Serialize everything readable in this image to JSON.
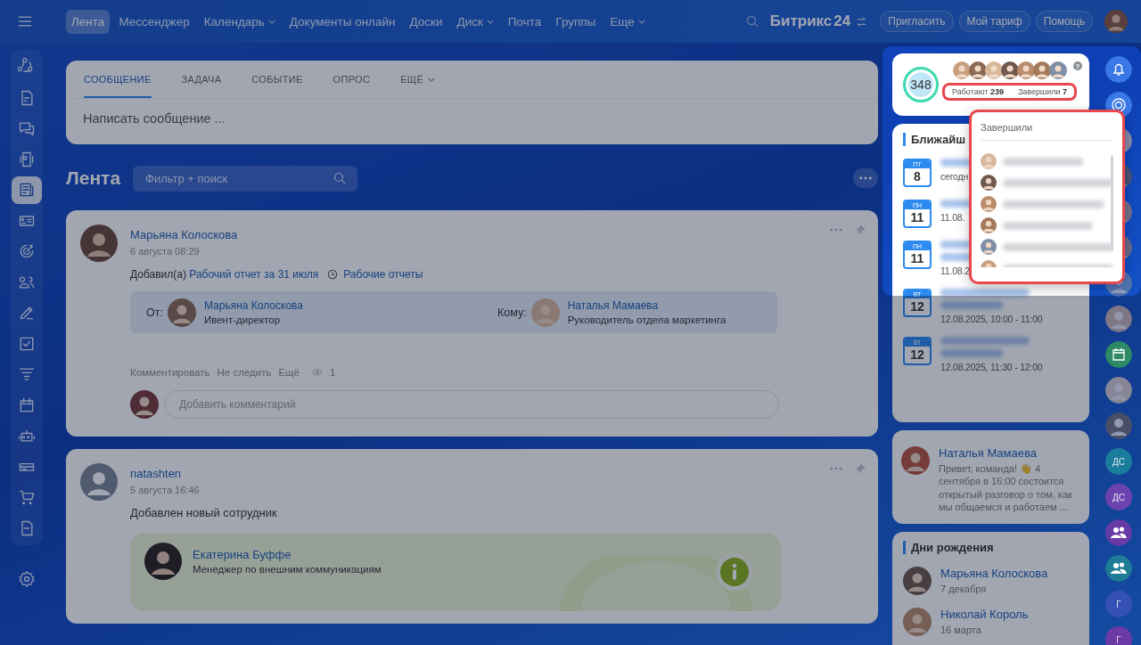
{
  "topbar": {
    "menu": [
      {
        "label": "Лента",
        "selected": true,
        "dropdown": false
      },
      {
        "label": "Мессенджер",
        "selected": false,
        "dropdown": false
      },
      {
        "label": "Календарь",
        "selected": false,
        "dropdown": true
      },
      {
        "label": "Документы онлайн",
        "selected": false,
        "dropdown": false
      },
      {
        "label": "Доски",
        "selected": false,
        "dropdown": false
      },
      {
        "label": "Диск",
        "selected": false,
        "dropdown": true
      },
      {
        "label": "Почта",
        "selected": false,
        "dropdown": false
      },
      {
        "label": "Группы",
        "selected": false,
        "dropdown": false
      },
      {
        "label": "Еще",
        "selected": false,
        "dropdown": true
      }
    ],
    "logo": {
      "name": "Битрикс",
      "number": "24"
    },
    "buttons": [
      "Пригласить",
      "Мой тариф",
      "Помощь"
    ]
  },
  "sidebar": {
    "items": [
      {
        "selected": false
      },
      {
        "selected": false
      },
      {
        "selected": false
      },
      {
        "selected": false
      },
      {
        "selected": true
      },
      {
        "selected": false
      },
      {
        "selected": false
      },
      {
        "selected": false
      },
      {
        "selected": false
      },
      {
        "selected": false
      },
      {
        "selected": false
      },
      {
        "selected": false
      },
      {
        "selected": false
      },
      {
        "selected": false
      },
      {
        "selected": false
      },
      {
        "selected": false
      }
    ]
  },
  "composer": {
    "tabs": [
      {
        "label": "СООБЩЕНИЕ",
        "selected": true,
        "dropdown": false
      },
      {
        "label": "ЗАДАЧА",
        "selected": false,
        "dropdown": false
      },
      {
        "label": "СОБЫТИЕ",
        "selected": false,
        "dropdown": false
      },
      {
        "label": "ОПРОС",
        "selected": false,
        "dropdown": false
      },
      {
        "label": "ЕЩЁ",
        "selected": false,
        "dropdown": true
      }
    ],
    "placeholder": "Написать сообщение ..."
  },
  "feed": {
    "title": "Лента",
    "search": {
      "placeholder": "Фильтр + поиск"
    }
  },
  "posts": [
    {
      "kind": "report",
      "author": "Марьяна Колоскова",
      "date": "6 августа 08:29",
      "action": "Добавил(а)",
      "link": "Рабочий отчет за 31 июля",
      "tag": "Рабочие отчеты",
      "from": {
        "label": "От:",
        "name": "Марьяна Колоскова",
        "role": "Ивент-директор"
      },
      "to": {
        "label": "Кому:",
        "name": "Наталья Мамаева",
        "role": "Руководитель отдела маркетинга"
      },
      "actions": [
        "Комментировать",
        "Не следить",
        "Ещё"
      ],
      "views": "1",
      "comment_placeholder": "Добавить комментарий"
    },
    {
      "kind": "employee",
      "author": "natashten",
      "date": "5 августа 16:46",
      "text": "Добавлен новый сотрудник",
      "employee": {
        "name": "Екатерина Буффе",
        "role": "Менеджер по внешним коммуникациям"
      }
    }
  ],
  "widget": {
    "count": "348",
    "help": "?",
    "stats": [
      {
        "label": "Работают",
        "value": "239"
      },
      {
        "label": "Завершили",
        "value": "7"
      }
    ]
  },
  "popup": {
    "title": "Завершили"
  },
  "events": {
    "title": "Ближайш",
    "items": [
      {
        "dow": "ПТ",
        "day": "8",
        "time": "сегодн"
      },
      {
        "dow": "ПН",
        "day": "11",
        "time": "11.08."
      },
      {
        "dow": "ПН",
        "day": "11",
        "time": "11.08.2"
      },
      {
        "dow": "ВТ",
        "day": "12",
        "time": "12.08.2025, 10:00 - 11:00"
      },
      {
        "dow": "ВТ",
        "day": "12",
        "time": "12.08.2025, 11:30 - 12:00"
      }
    ]
  },
  "news": {
    "author": "Наталья Мамаева",
    "text": "Привет, команда! 👋 4 сентября в 16:00 состоится открытый разговор о том, как мы общаемся и работаем ..."
  },
  "birthdays": {
    "title": "Дни рождения",
    "items": [
      {
        "name": "Марьяна Колоскова",
        "date": "7 декабря"
      },
      {
        "name": "Николай Король",
        "date": "16 марта"
      }
    ]
  },
  "strip": [
    {
      "kind": "bell"
    },
    {
      "kind": "activity"
    },
    {
      "kind": "avatar"
    },
    {
      "kind": "avatar"
    },
    {
      "kind": "avatar"
    },
    {
      "kind": "avatar"
    },
    {
      "kind": "avatar"
    },
    {
      "kind": "avatar"
    },
    {
      "kind": "calendar",
      "color": "#2e8a66"
    },
    {
      "kind": "avatar"
    },
    {
      "kind": "avatar"
    },
    {
      "kind": "initials",
      "text": "ДС",
      "color": "#1a7d9c"
    },
    {
      "kind": "initials",
      "text": "ДС",
      "color": "#6c42ae"
    },
    {
      "kind": "group",
      "color": "#673aa6"
    },
    {
      "kind": "group",
      "color": "#1f7c96"
    },
    {
      "kind": "initials",
      "text": "Г",
      "color": "#3551b6"
    },
    {
      "kind": "initials",
      "text": "Г",
      "color": "#6b3aa6"
    }
  ]
}
